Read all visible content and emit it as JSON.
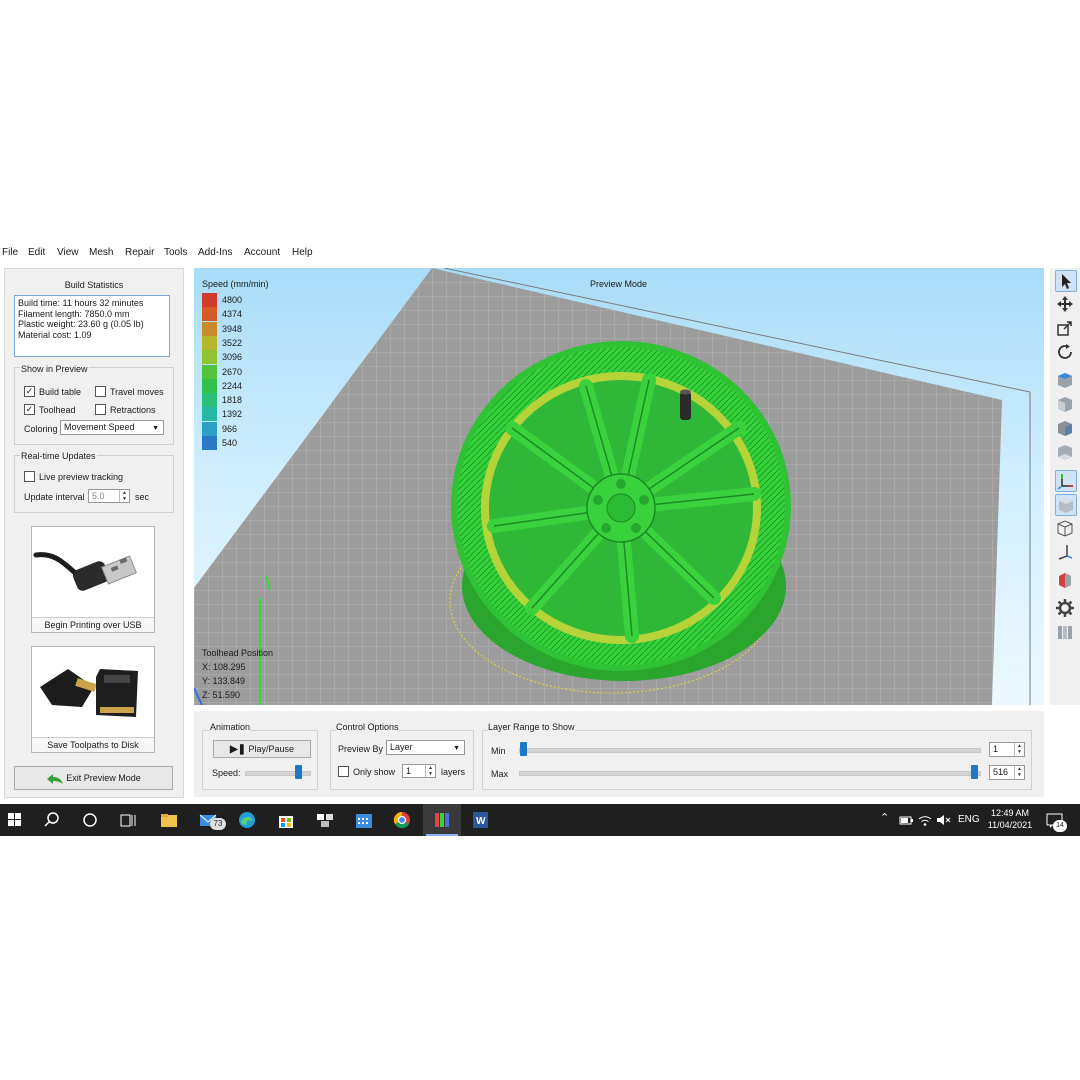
{
  "menu": [
    "File",
    "Edit",
    "View",
    "Mesh",
    "Repair",
    "Tools",
    "Add-Ins",
    "Account",
    "Help"
  ],
  "build_statistics": {
    "title": "Build Statistics",
    "lines": [
      "Build time: 11 hours 32 minutes",
      "Filament length: 7850.0 mm",
      "Plastic weight: 23.60 g (0.05 lb)",
      "Material cost: 1.09"
    ]
  },
  "show_in_preview": {
    "title": "Show in Preview",
    "build_table": {
      "label": "Build table",
      "checked": true
    },
    "travel_moves": {
      "label": "Travel moves",
      "checked": false
    },
    "toolhead": {
      "label": "Toolhead",
      "checked": true
    },
    "retractions": {
      "label": "Retractions",
      "checked": false
    },
    "coloring_label": "Coloring",
    "coloring_value": "Movement Speed"
  },
  "realtime": {
    "title": "Real-time Updates",
    "live_tracking": {
      "label": "Live preview tracking",
      "checked": false
    },
    "interval_label": "Update interval",
    "interval_value": "5.0",
    "interval_unit": "sec"
  },
  "usb_card_label": "Begin Printing over USB",
  "sd_card_label": "Save Toolpaths to Disk",
  "exit_button": "Exit Preview Mode",
  "viewport": {
    "legend_title": "Speed (mm/min)",
    "legend": [
      {
        "value": "4800",
        "color": "#d23a2a"
      },
      {
        "value": "4374",
        "color": "#d55a28"
      },
      {
        "value": "3948",
        "color": "#c98a2a"
      },
      {
        "value": "3522",
        "color": "#b6b82c"
      },
      {
        "value": "3096",
        "color": "#8ec432"
      },
      {
        "value": "2670",
        "color": "#52c23a"
      },
      {
        "value": "2244",
        "color": "#2fc24a"
      },
      {
        "value": "1818",
        "color": "#2ac07a"
      },
      {
        "value": "1392",
        "color": "#28b8a8"
      },
      {
        "value": "966",
        "color": "#2aa0c8"
      },
      {
        "value": "540",
        "color": "#2a78c8"
      }
    ],
    "mode_title": "Preview Mode",
    "toolhead_title": "Toolhead Position",
    "toolhead_x": "X: 108.295",
    "toolhead_y": "Y: 133.849",
    "toolhead_z": "Z: 51.590"
  },
  "animation": {
    "title": "Animation",
    "play_label": "Play/Pause",
    "speed_label": "Speed:",
    "speed_level": 0.85
  },
  "control_options": {
    "title": "Control Options",
    "preview_by_label": "Preview By",
    "preview_by_value": "Layer",
    "only_show": {
      "label": "Only show",
      "checked": false
    },
    "only_show_value": "1",
    "layers_label": "layers"
  },
  "layer_range": {
    "title": "Layer Range to Show",
    "min_label": "Min",
    "max_label": "Max",
    "min_value": "1",
    "max_value": "516"
  },
  "taskbar": {
    "mail_badge": "73",
    "time": "12:49 AM",
    "date": "11/04/2021",
    "lang": "ENG",
    "notif_count": "14"
  }
}
